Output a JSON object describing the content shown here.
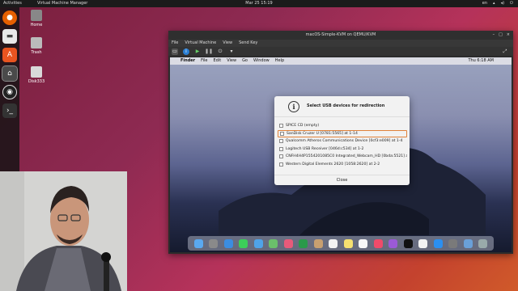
{
  "topbar": {
    "activities": "Activities",
    "app_name": "Virtual Machine Manager",
    "clock": "Mar 25  15:19",
    "lang": "en"
  },
  "desktop": {
    "icons": [
      {
        "label": "Home"
      },
      {
        "label": "Trash"
      },
      {
        "label": "Disk333"
      }
    ]
  },
  "vm": {
    "title": "macOS-Simple-KVM on QEMU/KVM",
    "menu": [
      "File",
      "Virtual Machine",
      "View",
      "Send Key"
    ],
    "guest": {
      "menubar": [
        "Finder",
        "File",
        "Edit",
        "View",
        "Go",
        "Window",
        "Help"
      ],
      "clock": "Thu 6:18 AM"
    }
  },
  "dialog": {
    "title": "Select USB devices for redirection",
    "devices": [
      "SPICE CD (empty)",
      "SanDisk Cruzer U [0781:5565] at 1-14",
      "Qualcomm Atheros Communications Device [0cf3:e009] at 1-4",
      "Logitech USB Receiver [046d:c534] at 1-2",
      "CNFH4H4P1554201085C0 Integrated_Webcam_HD [0bda:5521] at 1-3",
      "Western Digital Elements 2620 [1058:2620] at 2-2"
    ],
    "close_label": "Close"
  },
  "colors": {
    "accent": "#e0823a",
    "dock_bg": "#141414"
  }
}
